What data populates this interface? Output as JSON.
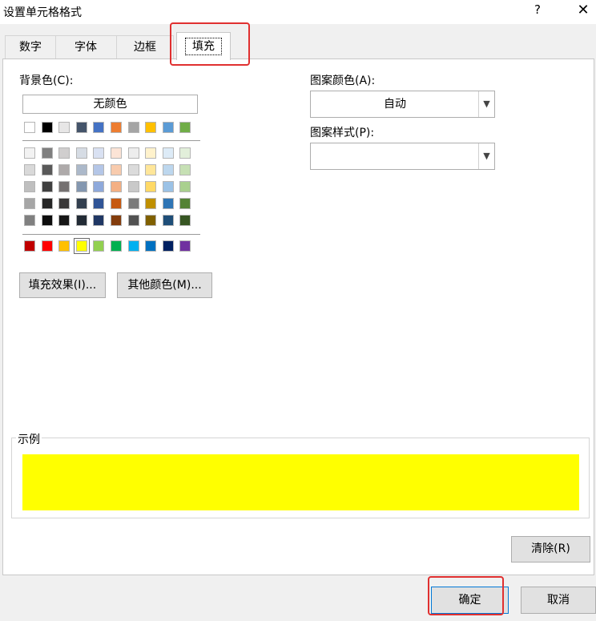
{
  "window": {
    "title": "设置单元格格式",
    "help_glyph": "?",
    "close_glyph": "✕"
  },
  "tabs": [
    {
      "label": "数字",
      "active": false
    },
    {
      "label": "字体",
      "active": false
    },
    {
      "label": "边框",
      "active": false
    },
    {
      "label": "填充",
      "active": true
    }
  ],
  "fill": {
    "background_label": "背景色(C):",
    "no_color_label": "无颜色",
    "selected_color": "#FFFF00",
    "theme_row": [
      "#FFFFFF",
      "#000000",
      "#E7E6E6",
      "#44546A",
      "#4472C4",
      "#ED7D31",
      "#A5A5A5",
      "#FFC000",
      "#5B9BD5",
      "#70AD47"
    ],
    "shade_rows": [
      [
        "#F2F2F2",
        "#7F7F7F",
        "#D0CECE",
        "#D6DCE4",
        "#D9E1F2",
        "#FCE4D6",
        "#EDEDED",
        "#FFF2CC",
        "#DDEBF7",
        "#E2EFDA"
      ],
      [
        "#D9D9D9",
        "#595959",
        "#AEAAAA",
        "#ACB9CA",
        "#B4C6E7",
        "#F8CBAD",
        "#DBDBDB",
        "#FFE699",
        "#BDD7EE",
        "#C6E0B4"
      ],
      [
        "#BFBFBF",
        "#404040",
        "#757171",
        "#8497B0",
        "#8EA9DB",
        "#F4B084",
        "#C9C9C9",
        "#FFD966",
        "#9BC2E6",
        "#A9D08E"
      ],
      [
        "#A6A6A6",
        "#262626",
        "#3A3838",
        "#333F4F",
        "#305496",
        "#C65911",
        "#7B7B7B",
        "#BF8F00",
        "#2F75B5",
        "#548235"
      ],
      [
        "#808080",
        "#0D0D0D",
        "#161616",
        "#222B35",
        "#203764",
        "#833C0C",
        "#525252",
        "#806000",
        "#1F4E78",
        "#375623"
      ]
    ],
    "standard_row": [
      "#C00000",
      "#FF0000",
      "#FFC000",
      "#FFFF00",
      "#92D050",
      "#00B050",
      "#00B0F0",
      "#0070C0",
      "#002060",
      "#7030A0"
    ],
    "fill_effects_button": "填充效果(I)...",
    "more_colors_button": "其他颜色(M)...",
    "pattern_color_label": "图案颜色(A):",
    "pattern_color_value": "自动",
    "pattern_style_label": "图案样式(P):",
    "pattern_style_value": "",
    "sample_label": "示例",
    "clear_button": "清除(R)"
  },
  "footer": {
    "ok_button": "确定",
    "cancel_button": "取消"
  },
  "highlight_color": "#E03030"
}
